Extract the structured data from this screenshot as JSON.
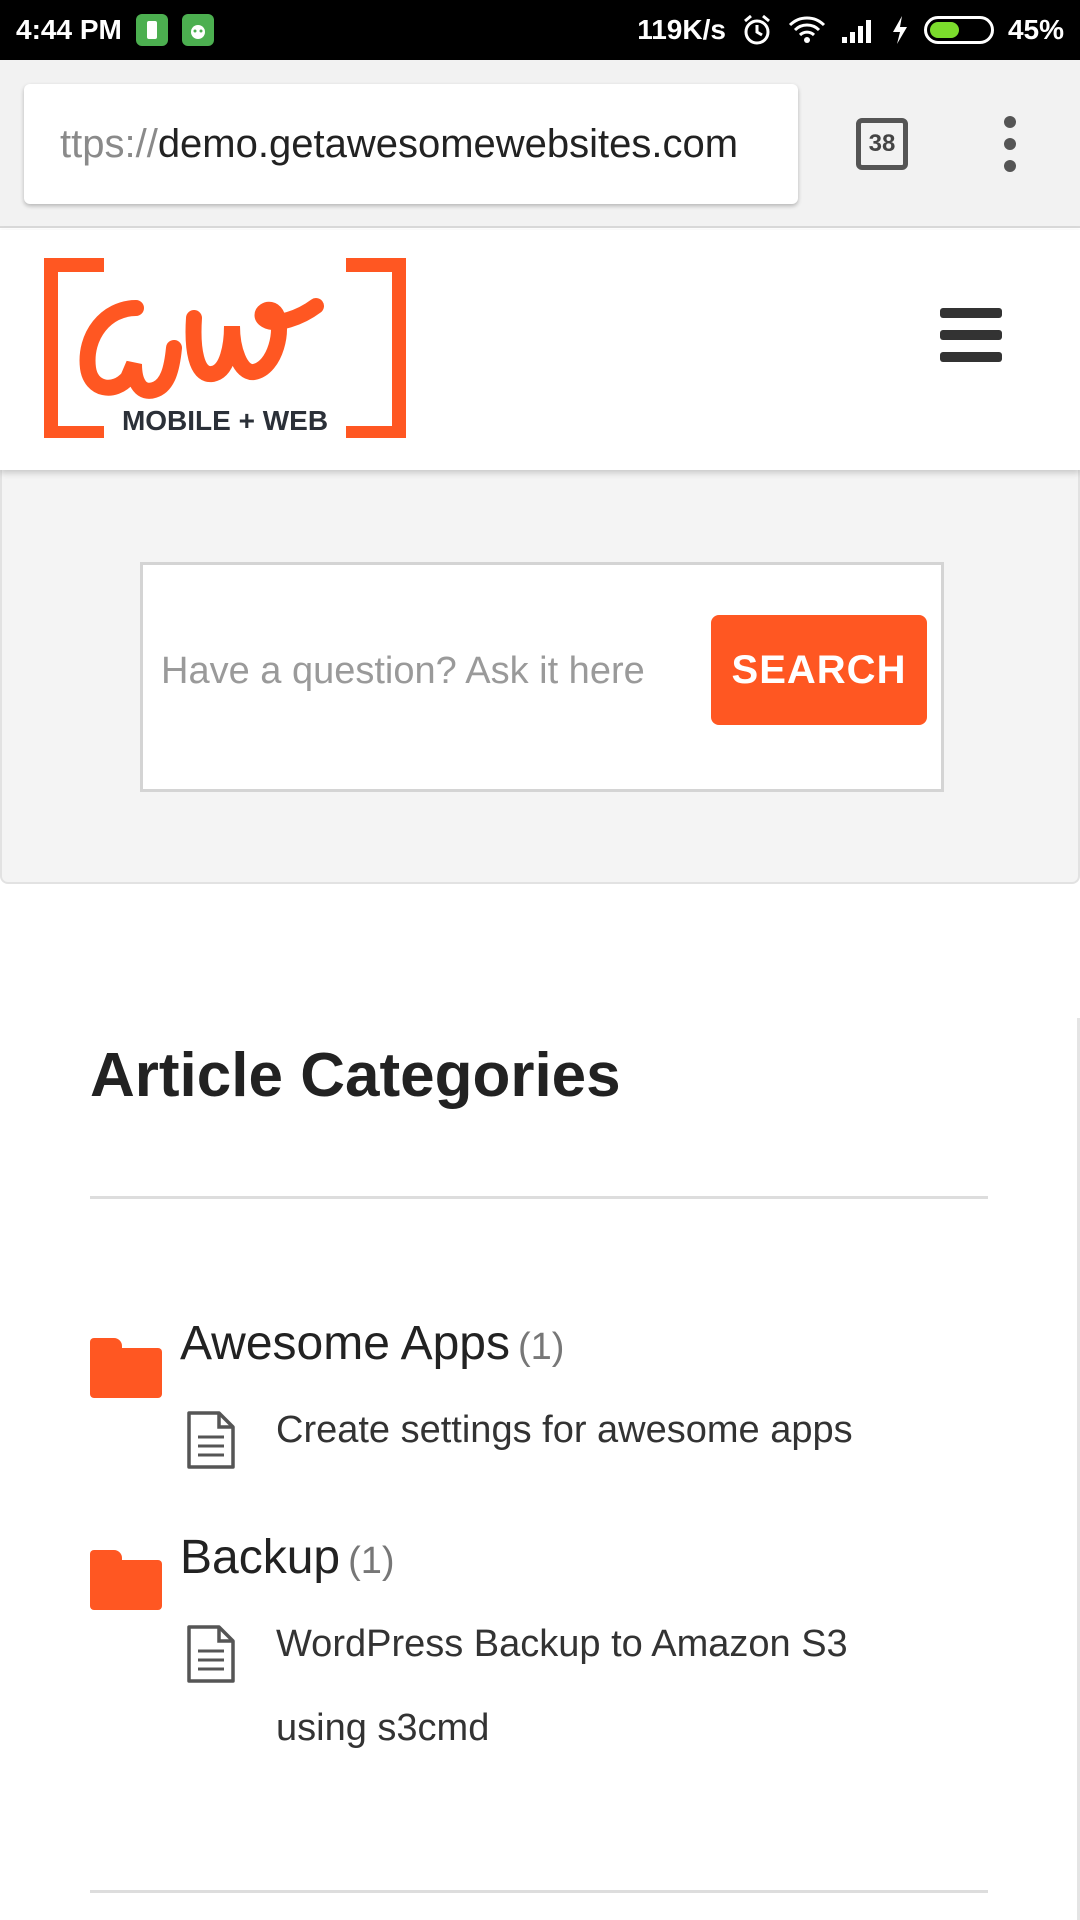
{
  "status_bar": {
    "time": "4:44 PM",
    "speed": "119K/s",
    "battery_percent": "45%",
    "battery_level": 0.45
  },
  "browser": {
    "url_scheme": "ttps://",
    "url_host": "demo.getawesomewebsites.com",
    "tab_count": "38"
  },
  "site": {
    "logo_text": "aw",
    "logo_tagline": "MOBILE + WEB",
    "brand_color": "#ff5722"
  },
  "search": {
    "placeholder": "Have a question? Ask it here",
    "button_label": "SEARCH"
  },
  "categories": {
    "title": "Article Categories",
    "items": [
      {
        "name": "Awesome Apps",
        "count": "(1)",
        "articles": [
          "Create settings for awesome apps"
        ]
      },
      {
        "name": "Backup",
        "count": "(1)",
        "articles": [
          "WordPress Backup to Amazon S3 using s3cmd"
        ]
      }
    ]
  },
  "icons": {
    "folder": "folder-icon",
    "document": "document-icon",
    "menu": "hamburger-menu-icon",
    "overflow": "more-vert-icon"
  }
}
